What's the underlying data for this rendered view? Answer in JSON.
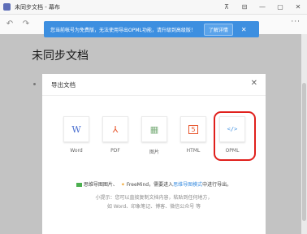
{
  "window": {
    "title": "未同步文档 - 幕布",
    "controls": [
      "⊼",
      "⊟",
      "—",
      "▢",
      "✕"
    ]
  },
  "toolbar": {
    "undo": "↶",
    "redo": "↷",
    "more": "···"
  },
  "toast": {
    "message": "您当前帐号为免费版，无法使用导出OPML功能，请升级到高级版！",
    "button_label": "了解详情",
    "close": "✕"
  },
  "document": {
    "title": "未同步文档"
  },
  "dialog": {
    "title": "导出文档",
    "close": "✕",
    "formats": [
      {
        "label": "Word",
        "glyph": "W",
        "color": "#4a6fd0",
        "icon": "word-icon"
      },
      {
        "label": "PDF",
        "glyph": "⅄",
        "color": "#e8572e",
        "icon": "pdf-icon"
      },
      {
        "label": "图片",
        "glyph": "▦",
        "color": "#7fb07f",
        "icon": "image-icon"
      },
      {
        "label": "HTML",
        "glyph": "5",
        "color": "#e8572e",
        "icon": "html-icon"
      },
      {
        "label": "OPML",
        "glyph": "</>",
        "color": "#3d8fe0",
        "icon": "opml-icon"
      }
    ],
    "mindmap_note": {
      "part1": "思维导图图片、",
      "part2": "FreeMind，需要进入",
      "link": "思维导图模式",
      "part3": "中进行导出。"
    },
    "tip_line1": "小提示：您可以直接复制文档内容，粘贴到任何地方，",
    "tip_line2": "如 Word、印象笔记、博客、微信公众号 等"
  }
}
